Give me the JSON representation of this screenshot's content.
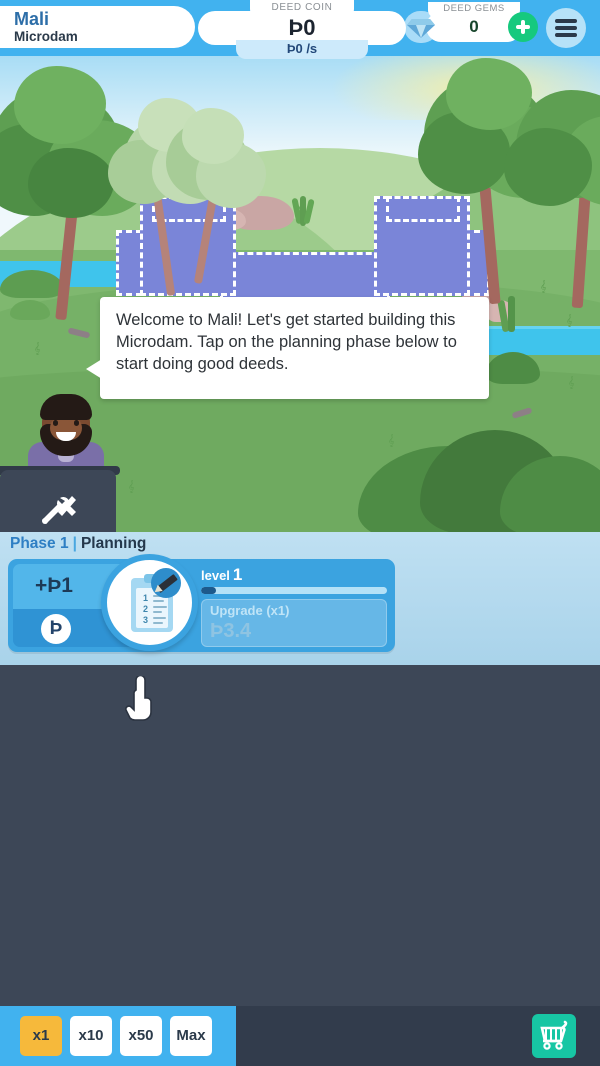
{
  "header": {
    "country": "Mali",
    "project": "Microdam",
    "coin": {
      "label": "DEED COIN",
      "amount": "Þ0",
      "rate": "Þ0 /s"
    },
    "gems": {
      "label": "DEED GEMS",
      "amount": "0",
      "icon": "gem-icon",
      "add_icon": "plus-icon"
    },
    "menu_icon": "hamburger-menu-icon",
    "accent": "#41b2ef"
  },
  "scene": {
    "structure_name": "dam-blueprint",
    "tools_icon": "tools-icon",
    "character_name": "engineer-avatar"
  },
  "tutorial": {
    "text": "Welcome to Mali! Let's get started building this Microdam. Tap on the planning phase below to start doing good deeds."
  },
  "phase": {
    "number": "Phase 1",
    "separator": "|",
    "name": "Planning",
    "card": {
      "gain": "+Þ1",
      "coin_symbol": "Þ",
      "icon": "clipboard-pencil-icon",
      "level_label": "level",
      "level_value": "1",
      "progress_percent": 8,
      "upgrade_label": "Upgrade (x1)",
      "upgrade_cost": "Þ3.4"
    }
  },
  "cursor": {
    "icon": "pointing-hand-cursor"
  },
  "bottom_bar": {
    "multipliers": [
      {
        "label": "x1",
        "selected": true
      },
      {
        "label": "x10",
        "selected": false
      },
      {
        "label": "x50",
        "selected": false
      },
      {
        "label": "Max",
        "selected": false
      }
    ],
    "shop_icon": "shopping-cart-icon",
    "shop_color": "#17c6a4"
  }
}
